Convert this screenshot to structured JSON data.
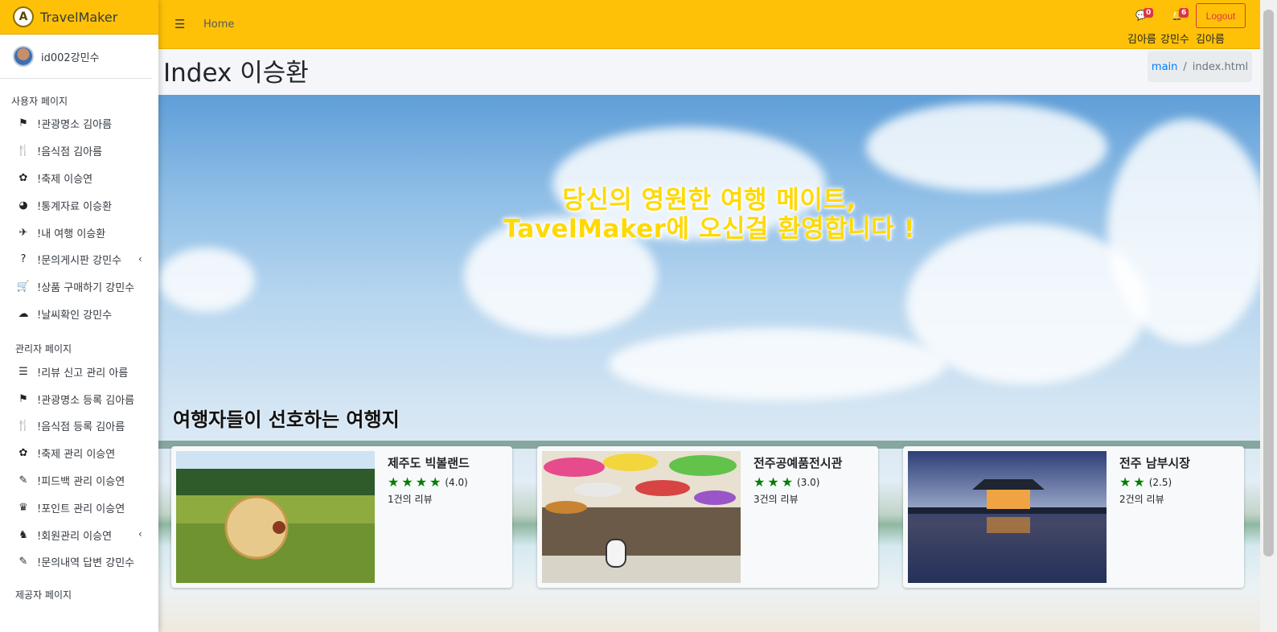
{
  "brand": {
    "name": "TravelMaker",
    "logo_letter": "A"
  },
  "user": {
    "name": "id002강민수"
  },
  "sidebar": {
    "user_section": {
      "header": "사용자 페이지",
      "items": [
        {
          "icon": "flag-icon",
          "glyph": "⚑",
          "label": "!관광명소 김아름"
        },
        {
          "icon": "utensils-icon",
          "glyph": "🍴",
          "label": "!음식점 김아름"
        },
        {
          "icon": "festival-icon",
          "glyph": "✿",
          "label": "!축제 이승연"
        },
        {
          "icon": "pie-chart-icon",
          "glyph": "◕",
          "label": "!통계자료 이승환"
        },
        {
          "icon": "plane-icon",
          "glyph": "✈",
          "label": "!내 여행 이승환"
        },
        {
          "icon": "question-circle-icon",
          "glyph": "?",
          "label": "!문의게시판 강민수",
          "has_caret": true
        },
        {
          "icon": "cart-icon",
          "glyph": "🛒",
          "label": "!상품 구매하기 강민수"
        },
        {
          "icon": "weather-icon",
          "glyph": "☁",
          "label": "!날씨확인 강민수"
        }
      ]
    },
    "admin_section": {
      "header": "관리자 페이지",
      "items": [
        {
          "icon": "list-check-icon",
          "glyph": "☰",
          "label": "!리뷰 신고 관리 아름"
        },
        {
          "icon": "flag-icon",
          "glyph": "⚑",
          "label": "!관광명소 등록 김아름"
        },
        {
          "icon": "utensils-icon",
          "glyph": "🍴",
          "label": "!음식점 등록 김아름"
        },
        {
          "icon": "festival-icon",
          "glyph": "✿",
          "label": "!축제 관리 이승연"
        },
        {
          "icon": "brush-icon",
          "glyph": "✎",
          "label": "!피드백 관리 이승연"
        },
        {
          "icon": "crown-icon",
          "glyph": "♛",
          "label": "!포인트 관리 이승연"
        },
        {
          "icon": "user-manage-icon",
          "glyph": "♞",
          "label": "!회원관리 이승연",
          "has_caret": true
        },
        {
          "icon": "brush-icon",
          "glyph": "✎",
          "label": "!문의내역 답변 강민수"
        }
      ]
    },
    "partial_header": "제공자 페이지"
  },
  "navbar": {
    "home_label": "Home",
    "messages_badge": "0",
    "notifications_badge": "6",
    "logout_label": "Logout",
    "names_1": "김아름",
    "names_2": "강민수",
    "names_3": "김아름"
  },
  "content_header": {
    "title": "Index 이승환",
    "breadcrumb_link": "main",
    "breadcrumb_sep": "/",
    "breadcrumb_active": "index.html"
  },
  "hero": {
    "line1": "당신의 영원한 여행 메이트,",
    "line2": "TavelMaker에 오신걸 환영합니다 !",
    "section_title": "여행자들이 선호하는 여행지"
  },
  "places": [
    {
      "name": "제주도 빅볼랜드",
      "stars": 4,
      "rating": "(4.0)",
      "reviews": "1건의 리뷰"
    },
    {
      "name": "전주공예품전시관",
      "stars": 3,
      "rating": "(3.0)",
      "reviews": "3건의 리뷰"
    },
    {
      "name": "전주 남부시장",
      "stars": 2,
      "rating": "(2.5)",
      "reviews": "2건의 리뷰"
    }
  ],
  "colors": {
    "accent": "#ffc107",
    "danger": "#dc3545",
    "star": "#008000",
    "hero_text": "#ffd900"
  }
}
